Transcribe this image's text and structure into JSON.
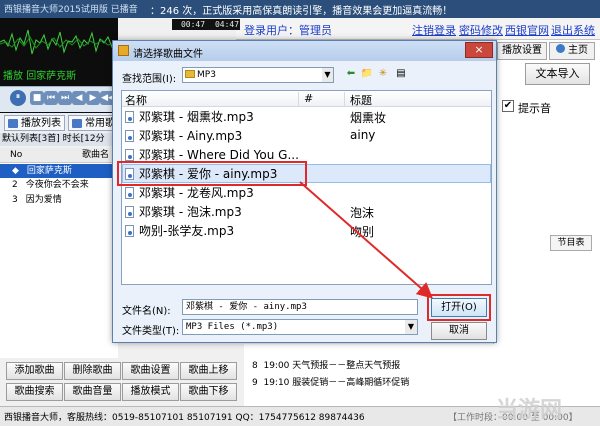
{
  "app": {
    "title": "西银播音大师2015试用版 已播音",
    "notice": "：246 次，正式版采用高保真朗读引擎，播音效果会更加逼真流畅！",
    "time1": "00:47",
    "time2": "04:47",
    "login_label": "登录用户：管理员",
    "links": [
      "注销登录",
      "密码修改",
      "西银官网",
      "退出系统"
    ],
    "tab_settings": "播放设置",
    "tab_home": "主页",
    "text_import": "文本导入",
    "tip_sound": "提示音",
    "tip_checked": "✔",
    "right_subtab": "节目表"
  },
  "player": {
    "now_playing_label": "播放",
    "now_playing_song": "回家萨克斯",
    "controls": [
      "⏸",
      "■",
      "⏮",
      "⏭",
      "◀",
      "▶",
      "◀◀",
      "▶▶"
    ],
    "tab_playlist": "播放列表",
    "tab_common": "常用歌",
    "list_status": "默认列表[3首] 时长[12分",
    "col_no": "No",
    "col_name": "歌曲名",
    "songs": [
      {
        "no": "◆",
        "name": "回家萨克斯"
      },
      {
        "no": "2",
        "name": "今夜你会不会来"
      },
      {
        "no": "3",
        "name": "因为爱情"
      }
    ]
  },
  "buttons": [
    "添加歌曲",
    "删除歌曲",
    "歌曲设置",
    "歌曲上移",
    "歌曲搜索",
    "歌曲音量",
    "播放模式",
    "歌曲下移"
  ],
  "schedule": [
    {
      "no": "8",
      "text": "19:00 天气预报－－整点天气预报"
    },
    {
      "no": "9",
      "text": "19:10 服装促销－－高峰期循环促销"
    }
  ],
  "status": {
    "text": "西银播音大师，客服热线：0519-85107101 85107191 QQ：1754775612 89874436",
    "work_time": "【工作时段：00:00 至 00:00】"
  },
  "watermark": "当游网",
  "dialog": {
    "title": "请选择歌曲文件",
    "close": "×",
    "lookin_label": "查找范围(I):",
    "lookin_value": "MP3",
    "nav_icons": [
      "⬅",
      "📁",
      "✳",
      "▤"
    ],
    "columns": [
      "名称",
      "#",
      "标题"
    ],
    "files": [
      {
        "name": "邓紫琪 - 烟熏妆.mp3",
        "title": "烟熏妆"
      },
      {
        "name": "邓紫琪 - Ainy.mp3",
        "title": "ainy"
      },
      {
        "name": "邓紫琪 - Where Did You G...",
        "title": ""
      },
      {
        "name": "邓紫棋 - 爱你 - ainy.mp3",
        "title": ""
      },
      {
        "name": "邓紫琪 - 龙卷风.mp3",
        "title": ""
      },
      {
        "name": "邓紫琪 - 泡沫.mp3",
        "title": "泡沫"
      },
      {
        "name": "吻别-张学友.mp3",
        "title": "吻别"
      }
    ],
    "filename_label": "文件名(N):",
    "filename_value": "邓紫棋 - 爱你 - ainy.mp3",
    "filetype_label": "文件类型(T):",
    "filetype_value": "MP3 Files (*.mp3)",
    "open_label": "打开(O)",
    "cancel_label": "取消"
  }
}
